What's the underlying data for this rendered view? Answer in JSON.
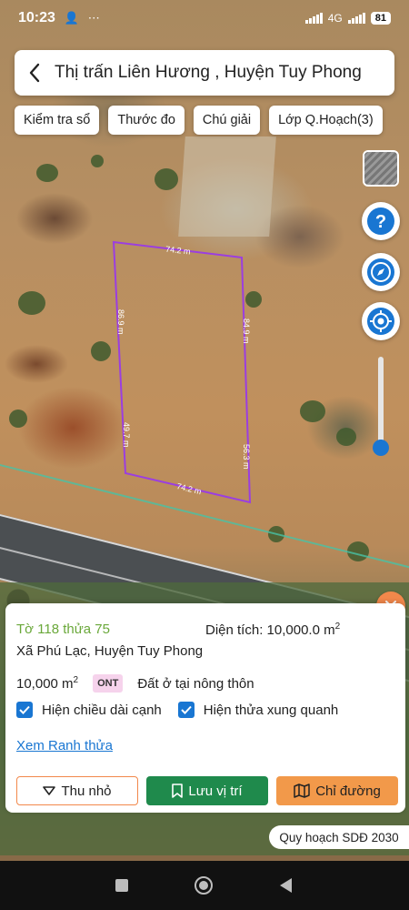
{
  "status_bar": {
    "time": "10:23",
    "network": "4G",
    "battery": "81"
  },
  "header": {
    "title": "Thị trấn Liên Hương , Huyện Tuy Phong"
  },
  "toolbar": {
    "chips": [
      {
        "label": "Kiểm tra sổ"
      },
      {
        "label": "Thước đo"
      },
      {
        "label": "Chú giải"
      },
      {
        "label": "Lớp Q.Hoạch(3)"
      }
    ]
  },
  "map": {
    "edge_labels": {
      "top": "74.2 m",
      "left_upper": "86.9 m",
      "right_upper": "84.9 m",
      "left_lower": "49.7 m",
      "right_lower": "56.3 m",
      "bottom": "74.2 m"
    },
    "zoom_slider_level": 0.1,
    "boundary_color": "#9b3ee0"
  },
  "info_panel": {
    "parcel_id": "Tờ 118 thửa 75",
    "area_prefix": "Diện tích: 10,000.0 m",
    "area_sup": "2",
    "address": "Xã Phú Lạc, Huyện Tuy Phong",
    "land_area": "10,000 m",
    "land_area_sup": "2",
    "land_code": "ONT",
    "land_type": "Đất ở tại nông thôn",
    "check_edge_lengths": "Hiện chiều dài cạnh",
    "check_neighbors": "Hiện thửa xung quanh",
    "view_boundary_link": "Xem Ranh thửa",
    "minimize_button": "Thu nhỏ",
    "save_button": "Lưu vị trí",
    "route_button": "Chỉ đường"
  },
  "plan_tag": "Quy hoạch SDĐ 2030",
  "colors": {
    "accent_orange": "#f2884b",
    "save_green": "#1f8a4c",
    "primary_blue": "#1976d2",
    "parcel_green": "#6aa83a"
  }
}
